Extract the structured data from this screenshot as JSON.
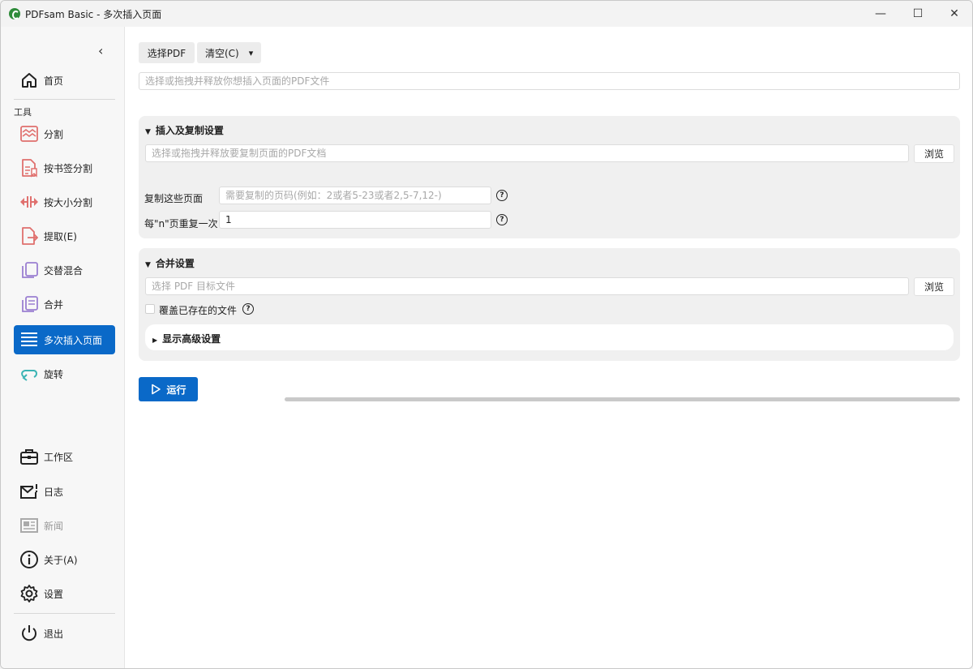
{
  "window": {
    "title": "PDFsam Basic - 多次插入页面",
    "min_glyph": "—",
    "max_glyph": "☐",
    "close_glyph": "✕"
  },
  "sidebar": {
    "collapse_glyph": "‹",
    "home": {
      "label": "首页",
      "icon": "home-icon"
    },
    "section_label": "工具",
    "tools": [
      {
        "label": "分割",
        "icon": "split-icon"
      },
      {
        "label": "按书签分割",
        "icon": "split-bookmarks-icon"
      },
      {
        "label": "按大小分割",
        "icon": "split-size-icon"
      },
      {
        "label": "提取(E)",
        "icon": "extract-icon"
      },
      {
        "label": "交替混合",
        "icon": "alternate-mix-icon"
      },
      {
        "label": "合并",
        "icon": "merge-icon"
      },
      {
        "label": "多次插入页面",
        "icon": "insert-pages-icon",
        "active": true
      },
      {
        "label": "旋转",
        "icon": "rotate-icon"
      }
    ],
    "bottom": [
      {
        "label": "工作区",
        "icon": "workspace-icon"
      },
      {
        "label": "日志",
        "icon": "log-icon"
      },
      {
        "label": "新闻",
        "icon": "news-icon",
        "disabled": true
      },
      {
        "label": "关于(A)",
        "icon": "info-icon"
      },
      {
        "label": "设置",
        "icon": "gear-icon"
      }
    ],
    "exit": {
      "label": "退出",
      "icon": "power-icon"
    }
  },
  "toolbar": {
    "select_pdf": "选择PDF",
    "clear": "清空(C)",
    "clear_arrow": "▾"
  },
  "main": {
    "drop_placeholder": "选择或拖拽并释放你想插入页面的PDF文件",
    "insert_panel": {
      "title": "插入及复制设置",
      "file_placeholder": "选择或拖拽并释放要复制页面的PDF文档",
      "browse": "浏览",
      "copy_pages_label": "复制这些页面",
      "copy_pages_placeholder": "需要复制的页码(例如：2或者5-23或者2,5-7,12-)",
      "repeat_label": "每\"n\"页重复一次",
      "repeat_value": "1",
      "help_glyph": "?"
    },
    "merge_panel": {
      "title": "合并设置",
      "target_placeholder": "选择 PDF 目标文件",
      "browse": "浏览",
      "overwrite_label": "覆盖已存在的文件",
      "help_glyph": "?",
      "advanced": "显示高级设置"
    },
    "run": "运行",
    "progress": 0
  },
  "colors": {
    "accent": "#0a69c8",
    "tool_icon": "#e0706e",
    "tool_icon_purple": "#9b7fd1",
    "rotate_icon": "#3bb4b4"
  }
}
